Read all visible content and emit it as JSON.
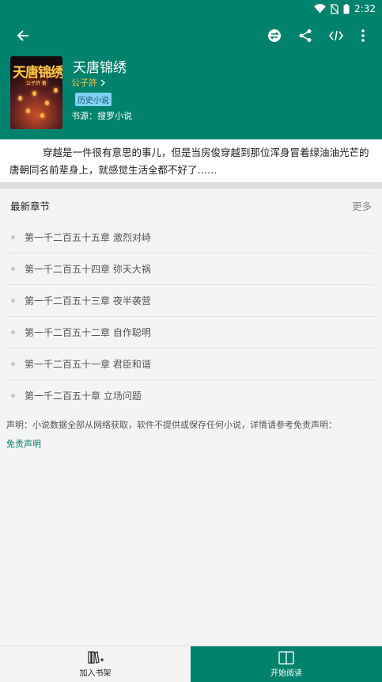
{
  "status_bar": {
    "time": "2:32"
  },
  "toolbar": {
    "back_icon": "arrow-left-icon",
    "actions": [
      "swap-source-icon",
      "share-icon",
      "code-icon",
      "more-vertical-icon"
    ]
  },
  "book": {
    "title": "天唐锦绣",
    "author": "公子許",
    "genre": "历史小说",
    "source": "书源：搜罗小说",
    "cover_title": "天唐锦绣",
    "cover_subtitle": "公子許 著"
  },
  "intro": {
    "text": "穿越是一件很有意思的事儿，但是当房俊穿越到那位浑身冒着绿油油光芒的唐朝同名前辈身上，就感觉生活全都不好了……"
  },
  "chapters": {
    "header": "最新章节",
    "more": "更多",
    "items": [
      "第一千二百五十五章 激烈对峙",
      "第一千二百五十四章 弥天大祸",
      "第一千二百五十三章 夜半袭营",
      "第一千二百五十二章 自作聪明",
      "第一千二百五十一章 君臣和谐",
      "第一千二百五十章 立场问题"
    ]
  },
  "notice": "声明：小说数据全部从网络获取，软件不提供或保存任何小说，详情请参考免责声明：",
  "disclaimer_link": "免责声明",
  "bottom_bar": {
    "add_shelf": "加入书架",
    "start_reading": "开始阅读"
  },
  "colors": {
    "primary": "#00826d",
    "author": "#f6c94a",
    "tag_bg": "#7fd3f2"
  }
}
